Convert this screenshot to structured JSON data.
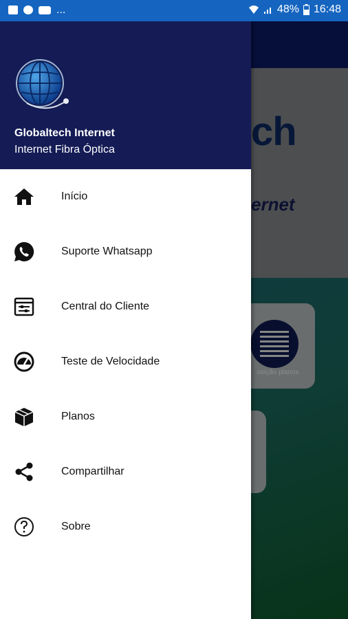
{
  "status_bar": {
    "left_icons": [
      "image-icon",
      "bixby-icon",
      "youtube-icon"
    ],
    "overflow": "...",
    "battery": "48%",
    "time": "16:48",
    "bg_color": "#1565c0"
  },
  "background_app": {
    "hero_title": "ch",
    "hero_subtitle": "ernet",
    "card_caption": "osição planos"
  },
  "drawer": {
    "title": "Globaltech Internet",
    "subtitle": "Internet Fibra Óptica",
    "header_color": "#141b55",
    "items": [
      {
        "label": "Início",
        "icon": "home-icon"
      },
      {
        "label": "Suporte Whatsapp",
        "icon": "whatsapp-icon"
      },
      {
        "label": "Central do Cliente",
        "icon": "client-panel-icon"
      },
      {
        "label": "Teste de Velocidade",
        "icon": "speedometer-icon"
      },
      {
        "label": "Planos",
        "icon": "box-icon"
      },
      {
        "label": "Compartilhar",
        "icon": "share-icon"
      },
      {
        "label": "Sobre",
        "icon": "help-icon"
      }
    ]
  }
}
